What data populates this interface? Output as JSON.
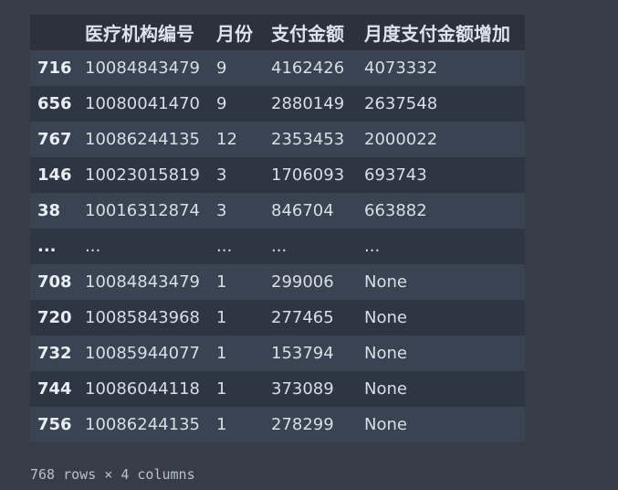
{
  "table": {
    "columns": [
      "",
      "医疗机构编号",
      "月份",
      "支付金额",
      "月度支付金额增加"
    ],
    "rows": [
      {
        "index": "716",
        "cells": [
          "10084843479",
          "9",
          "4162426",
          "4073332"
        ]
      },
      {
        "index": "656",
        "cells": [
          "10080041470",
          "9",
          "2880149",
          "2637548"
        ]
      },
      {
        "index": "767",
        "cells": [
          "10086244135",
          "12",
          "2353453",
          "2000022"
        ]
      },
      {
        "index": "146",
        "cells": [
          "10023015819",
          "3",
          "1706093",
          "693743"
        ]
      },
      {
        "index": "38",
        "cells": [
          "10016312874",
          "3",
          "846704",
          "663882"
        ]
      },
      {
        "index": "...",
        "cells": [
          "...",
          "...",
          "...",
          "..."
        ]
      },
      {
        "index": "708",
        "cells": [
          "10084843479",
          "1",
          "299006",
          "None"
        ]
      },
      {
        "index": "720",
        "cells": [
          "10085843968",
          "1",
          "277465",
          "None"
        ]
      },
      {
        "index": "732",
        "cells": [
          "10085944077",
          "1",
          "153794",
          "None"
        ]
      },
      {
        "index": "744",
        "cells": [
          "10086044118",
          "1",
          "373089",
          "None"
        ]
      },
      {
        "index": "756",
        "cells": [
          "10086244135",
          "1",
          "278299",
          "None"
        ]
      }
    ]
  },
  "footer": {
    "shape_text": "768 rows × 4 columns"
  }
}
